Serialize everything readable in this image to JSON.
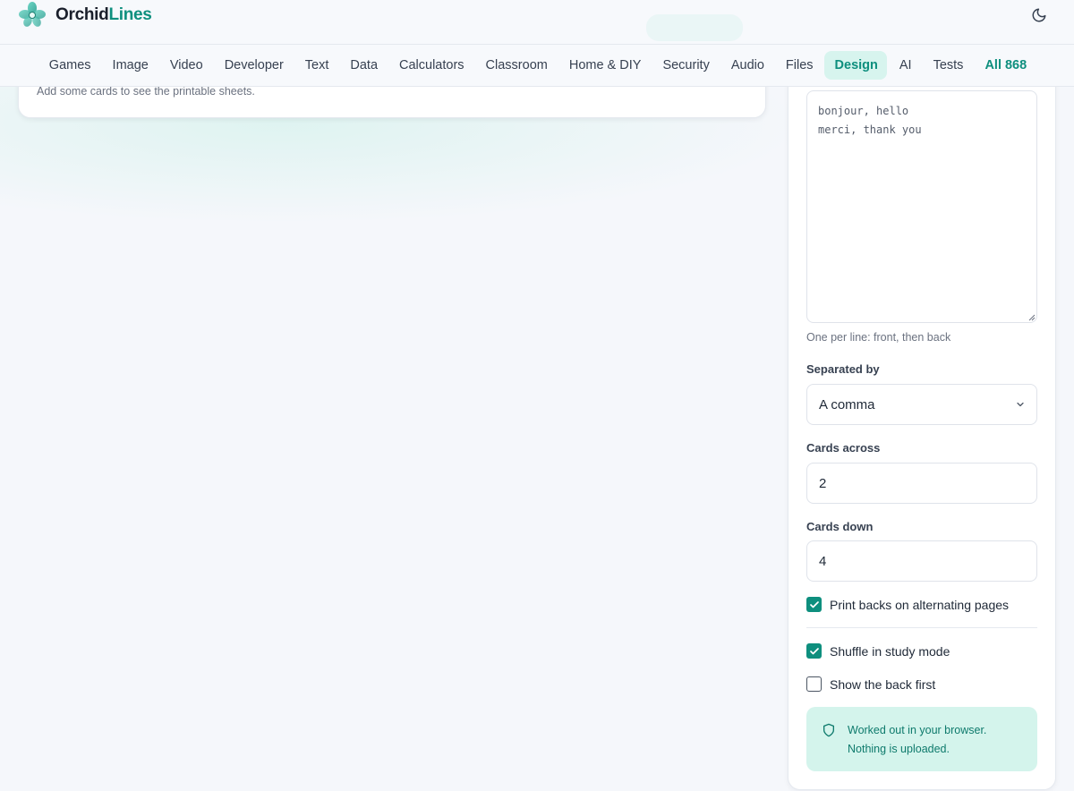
{
  "brand": {
    "name_main": "Orchid",
    "name_accent": "Lines",
    "accent_color": "#0e8f7e"
  },
  "header": {
    "theme_toggle_icon": "moon-icon"
  },
  "nav": {
    "items": [
      {
        "label": "Games"
      },
      {
        "label": "Image"
      },
      {
        "label": "Video"
      },
      {
        "label": "Developer"
      },
      {
        "label": "Text"
      },
      {
        "label": "Data"
      },
      {
        "label": "Calculators"
      },
      {
        "label": "Classroom"
      },
      {
        "label": "Home & DIY"
      },
      {
        "label": "Security"
      },
      {
        "label": "Audio"
      },
      {
        "label": "Files"
      },
      {
        "label": "Design",
        "active": true
      },
      {
        "label": "AI"
      },
      {
        "label": "Tests"
      }
    ],
    "all_label": "All 868"
  },
  "preview": {
    "empty_message": "Add some cards to see the printable sheets."
  },
  "form": {
    "cards_text": "bonjour, hello\nmerci, thank you",
    "cards_hint": "One per line: front, then back",
    "separator": {
      "label": "Separated by",
      "value": "A comma"
    },
    "cards_across": {
      "label": "Cards across",
      "value": "2"
    },
    "cards_down": {
      "label": "Cards down",
      "value": "4"
    },
    "print_backs": {
      "label": "Print backs on alternating pages",
      "checked": true
    },
    "shuffle": {
      "label": "Shuffle in study mode",
      "checked": true
    },
    "back_first": {
      "label": "Show the back first",
      "checked": false
    }
  },
  "privacy_notice": {
    "line1": "Worked out in your browser.",
    "line2": "Nothing is uploaded.",
    "icon": "shield-icon"
  }
}
